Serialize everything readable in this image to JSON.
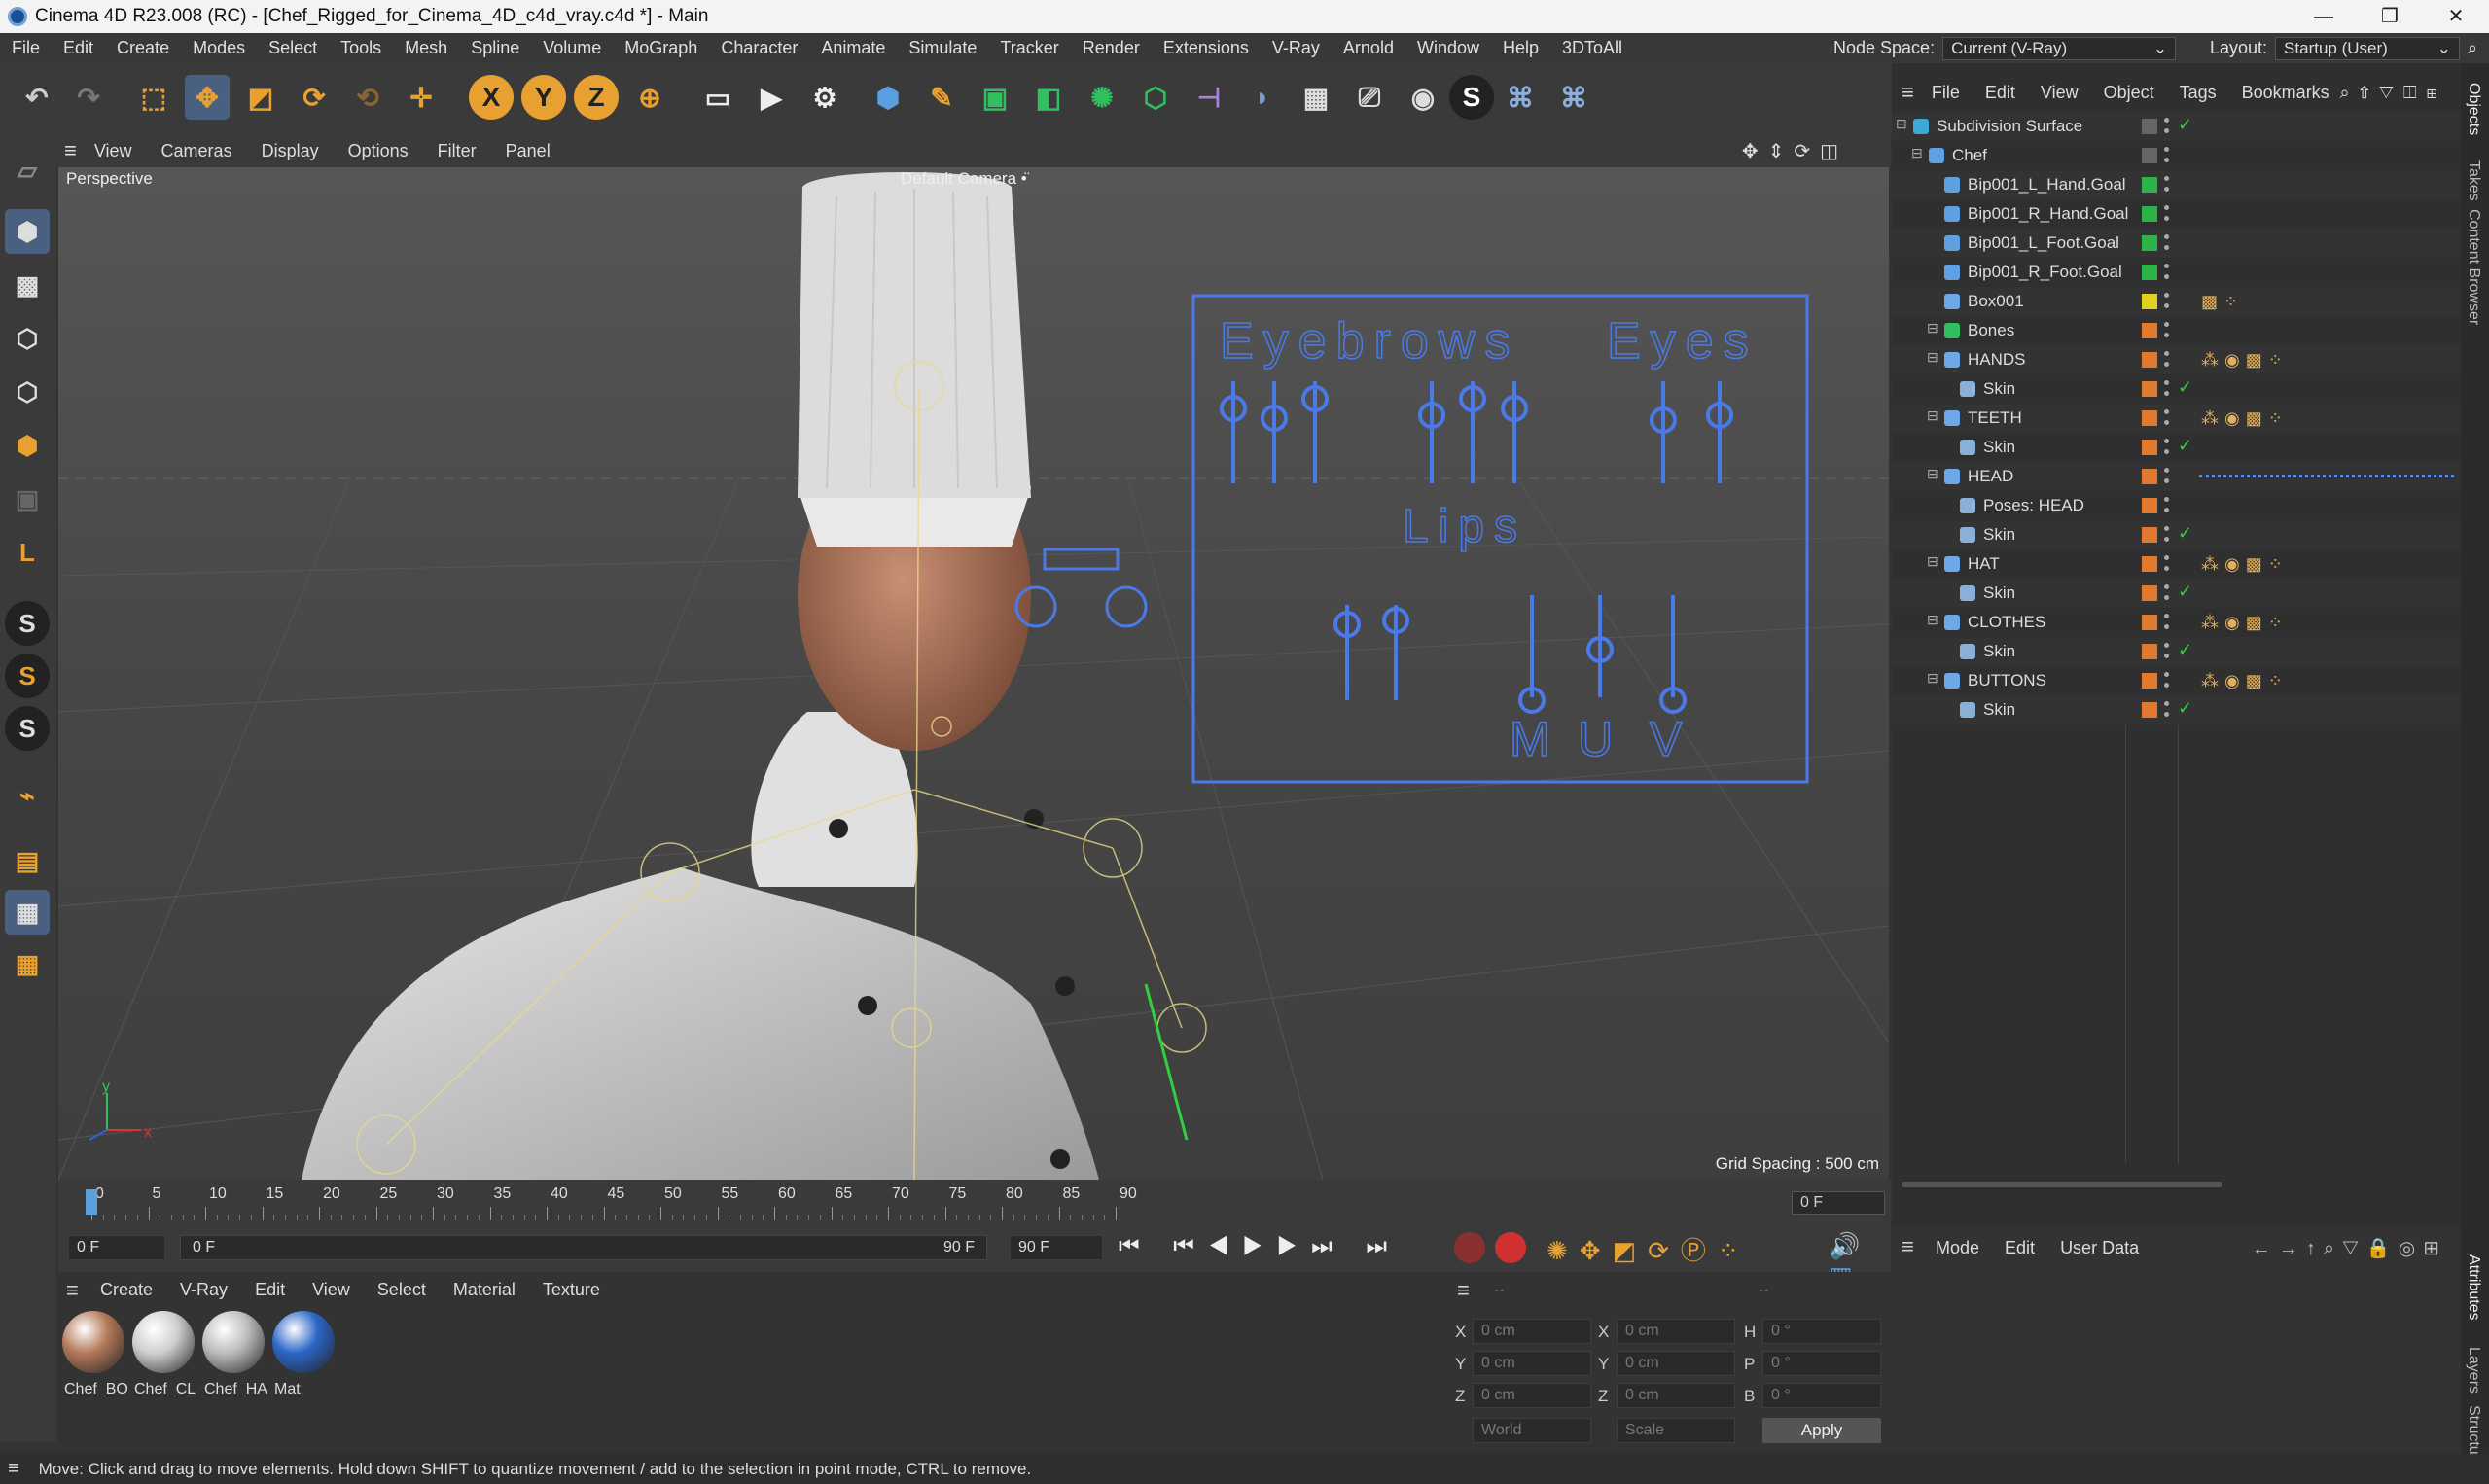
{
  "window": {
    "title": "Cinema 4D R23.008 (RC) - [Chef_Rigged_for_Cinema_4D_c4d_vray.c4d *] - Main",
    "min": "—",
    "max": "❐",
    "close": "✕"
  },
  "menu": [
    "File",
    "Edit",
    "Create",
    "Modes",
    "Select",
    "Tools",
    "Mesh",
    "Spline",
    "Volume",
    "MoGraph",
    "Character",
    "Animate",
    "Simulate",
    "Tracker",
    "Render",
    "Extensions",
    "V-Ray",
    "Arnold",
    "Window",
    "Help",
    "3DToAll"
  ],
  "nodespace": {
    "label": "Node Space:",
    "value": "Current (V-Ray)"
  },
  "layout": {
    "label": "Layout:",
    "value": "Startup (User)"
  },
  "viewport_menu": [
    "View",
    "Cameras",
    "Display",
    "Options",
    "Filter",
    "Panel"
  ],
  "viewport": {
    "name": "Perspective",
    "camera": "Default Camera",
    "grid_spacing": "Grid Spacing : 500 cm",
    "axis_y": "y",
    "axis_x": "x"
  },
  "rig_panel": {
    "eyebrows": "Eyebrows",
    "eyes": "Eyes",
    "lips": "Lips",
    "m": "M",
    "u": "U",
    "v": "V"
  },
  "timeline": {
    "ticks": [
      "0",
      "5",
      "10",
      "15",
      "20",
      "25",
      "30",
      "35",
      "40",
      "45",
      "50",
      "55",
      "60",
      "65",
      "70",
      "75",
      "80",
      "85",
      "90"
    ],
    "current": "0 F"
  },
  "transport": {
    "start": "0 F",
    "range_start": "0 F",
    "range_end": "90 F",
    "end": "90 F"
  },
  "materials_menu": [
    "Create",
    "V-Ray",
    "Edit",
    "View",
    "Select",
    "Material",
    "Texture"
  ],
  "materials": [
    {
      "label": "Chef_BO",
      "color": "#b47a5a"
    },
    {
      "label": "Chef_CL",
      "color": "#cfcfcf"
    },
    {
      "label": "Chef_HA",
      "color": "#bdbdbd"
    },
    {
      "label": "Mat",
      "color": "#2b66c8"
    }
  ],
  "coords": {
    "dash1": "--",
    "dash2": "--",
    "x": "X",
    "y": "Y",
    "z": "Z",
    "h": "H",
    "p": "P",
    "b": "B",
    "pos_x": "0 cm",
    "pos_y": "0 cm",
    "pos_z": "0 cm",
    "size_x": "0 cm",
    "size_y": "0 cm",
    "size_z": "0 cm",
    "rot_h": "0 °",
    "rot_p": "0 °",
    "rot_b": "0 °",
    "world": "World",
    "scale": "Scale",
    "apply": "Apply"
  },
  "object_menu": [
    "File",
    "Edit",
    "View",
    "Object",
    "Tags",
    "Bookmarks"
  ],
  "objects": [
    {
      "name": "Subdivision Surface",
      "indent": 0,
      "color": "#3ca8d8",
      "sq": "#666"
    },
    {
      "name": "Chef",
      "indent": 1,
      "color": "#5fa0e0",
      "sq": "#666"
    },
    {
      "name": "Bip001_L_Hand.Goal",
      "indent": 2,
      "color": "#5fa0e0",
      "sq": "#2db34a"
    },
    {
      "name": "Bip001_R_Hand.Goal",
      "indent": 2,
      "color": "#5fa0e0",
      "sq": "#2db34a"
    },
    {
      "name": "Bip001_L_Foot.Goal",
      "indent": 2,
      "color": "#5fa0e0",
      "sq": "#2db34a"
    },
    {
      "name": "Bip001_R_Foot.Goal",
      "indent": 2,
      "color": "#5fa0e0",
      "sq": "#2db34a"
    },
    {
      "name": "Box001",
      "indent": 2,
      "color": "#6fa8e8",
      "sq": "#e0d020"
    },
    {
      "name": "Bones",
      "indent": 2,
      "color": "#30c060",
      "sq": "#e07a30"
    },
    {
      "name": "HANDS",
      "indent": 2,
      "color": "#6fa8e8",
      "sq": "#e07a30"
    },
    {
      "name": "Skin",
      "indent": 3,
      "color": "#8ab0d8",
      "sq": "#e07a30"
    },
    {
      "name": "TEETH",
      "indent": 2,
      "color": "#6fa8e8",
      "sq": "#e07a30"
    },
    {
      "name": "Skin",
      "indent": 3,
      "color": "#8ab0d8",
      "sq": "#e07a30"
    },
    {
      "name": "HEAD",
      "indent": 2,
      "color": "#6fa8e8",
      "sq": "#e07a30"
    },
    {
      "name": "Poses: HEAD",
      "indent": 3,
      "color": "#8ab0d8",
      "sq": "#e07a30"
    },
    {
      "name": "Skin",
      "indent": 3,
      "color": "#8ab0d8",
      "sq": "#e07a30"
    },
    {
      "name": "HAT",
      "indent": 2,
      "color": "#6fa8e8",
      "sq": "#e07a30"
    },
    {
      "name": "Skin",
      "indent": 3,
      "color": "#8ab0d8",
      "sq": "#e07a30"
    },
    {
      "name": "CLOTHES",
      "indent": 2,
      "color": "#6fa8e8",
      "sq": "#e07a30"
    },
    {
      "name": "Skin",
      "indent": 3,
      "color": "#8ab0d8",
      "sq": "#e07a30"
    },
    {
      "name": "BUTTONS",
      "indent": 2,
      "color": "#6fa8e8",
      "sq": "#e07a30"
    },
    {
      "name": "Skin",
      "indent": 3,
      "color": "#8ab0d8",
      "sq": "#e07a30"
    }
  ],
  "attr_menu": [
    "Mode",
    "Edit",
    "User Data"
  ],
  "right_tabs": {
    "objects": "Objects",
    "takes": "Takes",
    "content": "Content Browser",
    "attributes": "Attributes",
    "layers": "Layers",
    "structure": "Structure"
  },
  "status": "Move: Click and drag to move elements. Hold down SHIFT to quantize movement / add to the selection in point mode, CTRL to remove."
}
